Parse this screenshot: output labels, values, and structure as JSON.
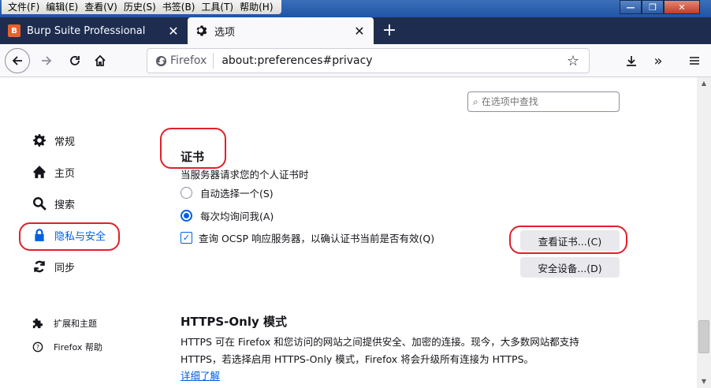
{
  "menubar": {
    "items": [
      "文件(F)",
      "编辑(E)",
      "查看(V)",
      "历史(S)",
      "书签(B)",
      "工具(T)",
      "帮助(H)"
    ]
  },
  "window_controls": {
    "minimize": "—",
    "maximize": "❐",
    "close": "✕"
  },
  "tabs": [
    {
      "title": "Burp Suite Professional",
      "close": "✕"
    },
    {
      "title": "选项",
      "close": "✕"
    }
  ],
  "new_tab": "+",
  "navbar": {
    "identity_label": "Firefox",
    "url": "about:preferences#privacy"
  },
  "search": {
    "placeholder": "在选项中查找"
  },
  "sidebar": {
    "items": [
      {
        "label": "常规",
        "icon": "gear-icon"
      },
      {
        "label": "主页",
        "icon": "home-icon"
      },
      {
        "label": "搜索",
        "icon": "search-icon"
      },
      {
        "label": "隐私与安全",
        "icon": "lock-icon",
        "selected": true
      },
      {
        "label": "同步",
        "icon": "sync-icon"
      }
    ],
    "footer": [
      {
        "label": "扩展和主题",
        "icon": "puzzle-icon"
      },
      {
        "label": "Firefox 帮助",
        "icon": "help-icon"
      }
    ]
  },
  "certificates": {
    "title": "证书",
    "description": "当服务器请求您的个人证书时",
    "options": [
      {
        "label": "自动选择一个(S)",
        "selected": false
      },
      {
        "label": "每次均询问我(A)",
        "selected": true
      }
    ],
    "ocsp_label": "查询 OCSP 响应服务器，以确认证书当前是否有效(Q)",
    "ocsp_checked": true,
    "view_certs_button": "查看证书...(C)",
    "security_devices_button": "安全设备...(D)"
  },
  "https_only": {
    "title": "HTTPS-Only 模式",
    "desc_line1": "HTTPS 可在 Firefox 和您访问的网站之间提供安全、加密的连接。现今，大多数网站都支持",
    "desc_line2": "HTTPS，若选择启用 HTTPS-Only 模式，Firefox 将会升级所有连接为 HTTPS。",
    "learn_more": "详细了解"
  },
  "colors": {
    "accent": "#0061e0",
    "annotation": "#e0202a",
    "tabstrip": "#1e2d4f"
  }
}
